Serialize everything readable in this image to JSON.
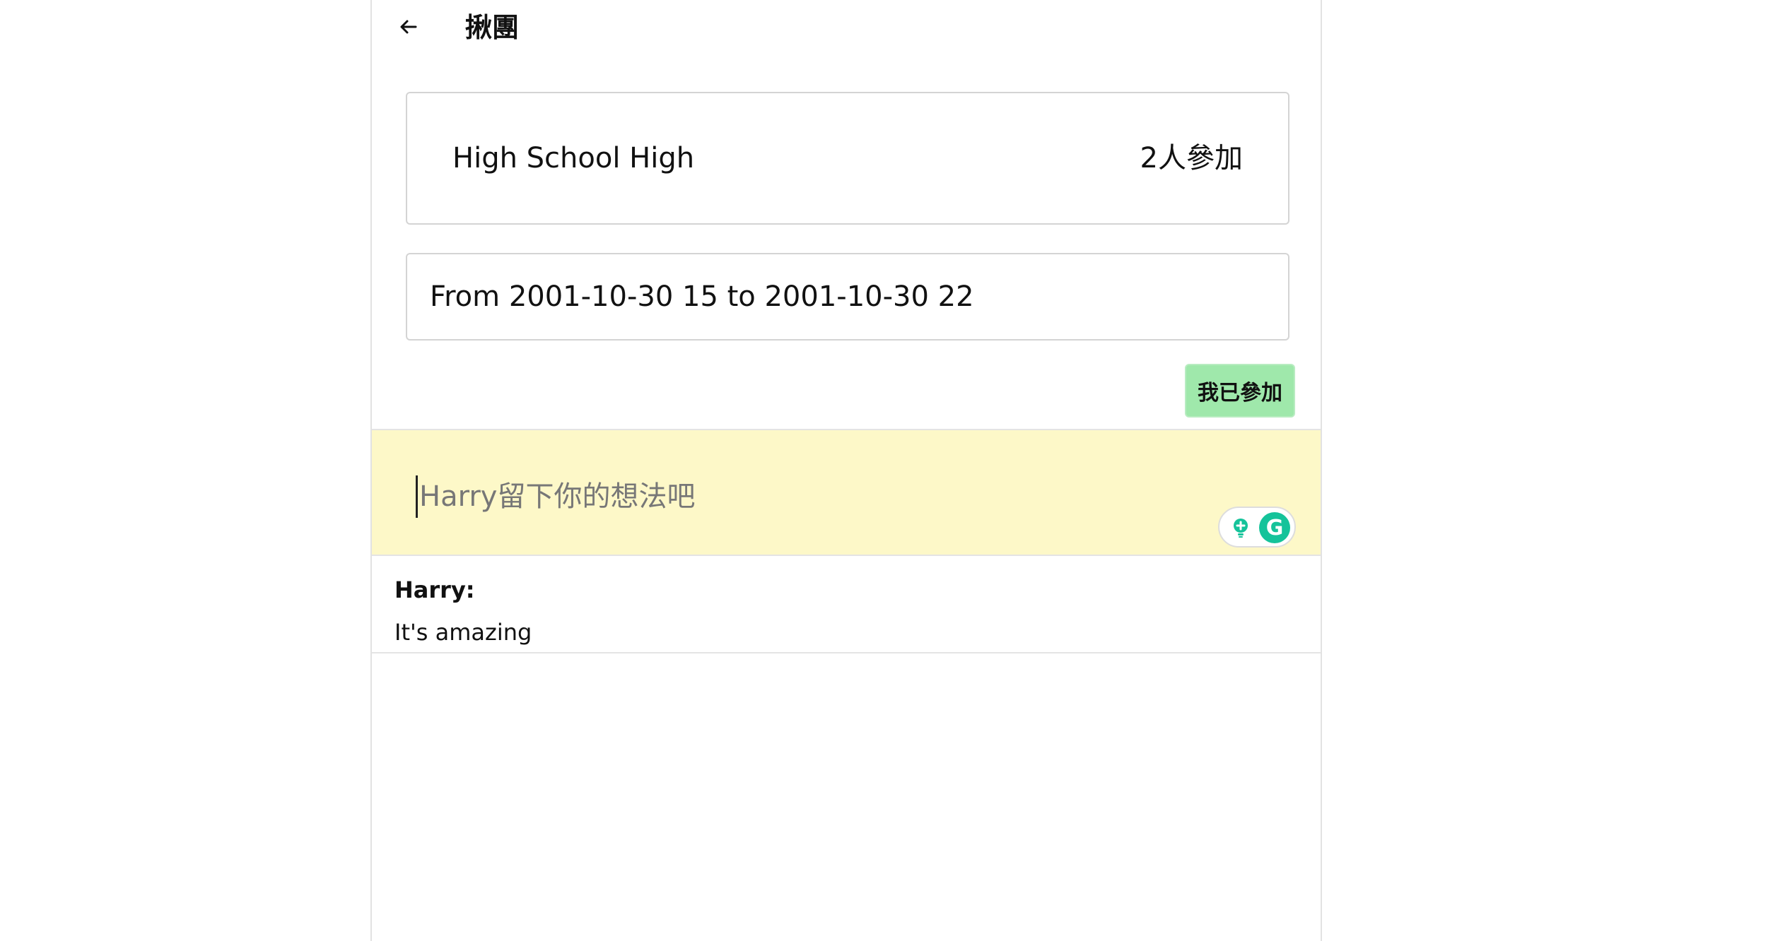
{
  "header": {
    "back_icon": "arrow-left-icon",
    "title": "揪團"
  },
  "event": {
    "name": "High School High",
    "participants": "2人參加"
  },
  "time": {
    "text": "From 2001-10-30 15 to 2001-10-30 22"
  },
  "join_button": {
    "label": "我已參加",
    "color": "#9fe8ab"
  },
  "comment_input": {
    "placeholder": "Harry留下你的想法吧",
    "background": "#fdf8c8"
  },
  "grammarly": {
    "bulb_icon": "lightbulb-icon",
    "logo_icon": "grammarly-icon",
    "logo_letter": "G"
  },
  "comments": [
    {
      "author": "Harry:",
      "text": "It's amazing"
    }
  ]
}
